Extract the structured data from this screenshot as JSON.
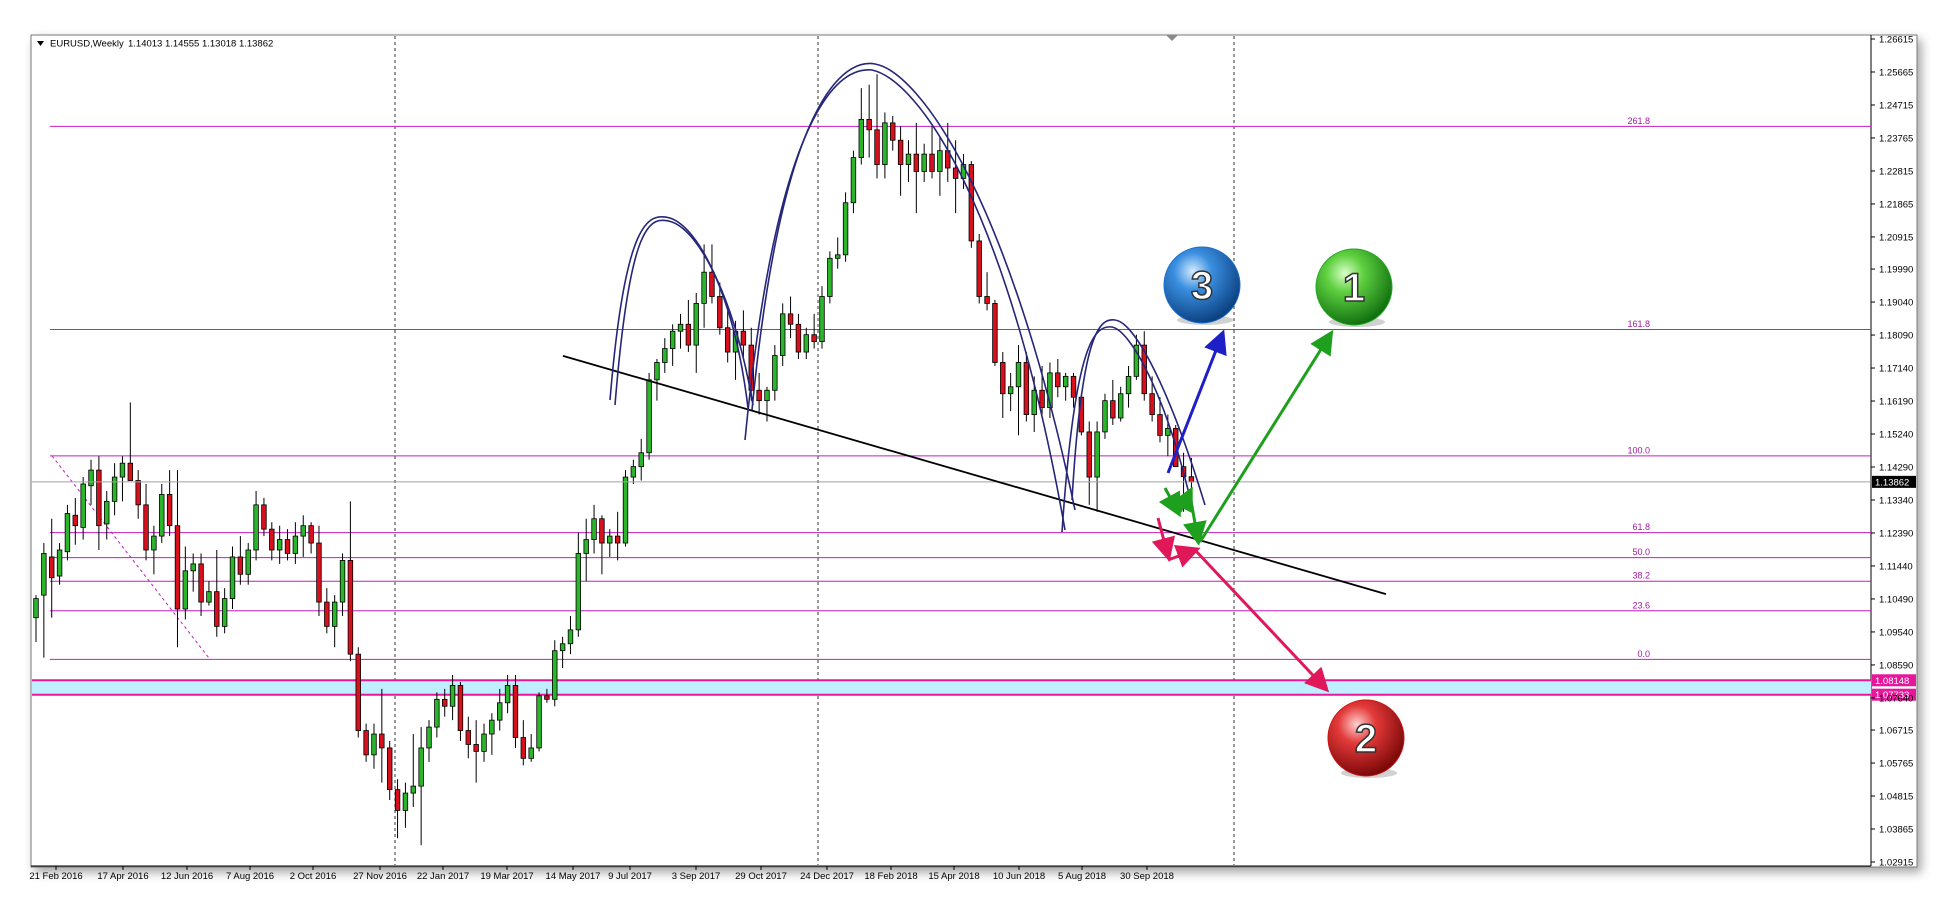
{
  "chart_data": {
    "type": "candlestick",
    "header": {
      "symbol_line": "EURUSD,Weekly",
      "ohlc_line": "1.14013 1.14555 1.13018 1.13862"
    },
    "y_axis": {
      "ylim": [
        1.02915,
        1.26615
      ],
      "ticks": [
        "1.26615",
        "1.25665",
        "1.24715",
        "1.23765",
        "1.22815",
        "1.21865",
        "1.20915",
        "1.19990",
        "1.19040",
        "1.18090",
        "1.17140",
        "1.16190",
        "1.15240",
        "1.14290",
        "1.13340",
        "1.12390",
        "1.11440",
        "1.10490",
        "1.09540",
        "1.08590",
        "1.07640",
        "1.06715",
        "1.05765",
        "1.04815",
        "1.03865",
        "1.02915"
      ]
    },
    "x_axis": {
      "ticks": [
        "21 Feb 2016",
        "17 Apr 2016",
        "12 Jun 2016",
        "7 Aug 2016",
        "2 Oct 2016",
        "27 Nov 2016",
        "22 Jan 2017",
        "19 Mar 2017",
        "14 May 2017",
        "9 Jul 2017",
        "3 Sep 2017",
        "29 Oct 2017",
        "24 Dec 2017",
        "18 Feb 2018",
        "15 Apr 2018",
        "10 Jun 2018",
        "5 Aug 2018",
        "30 Sep 2018"
      ]
    },
    "current_price": {
      "label": "1.13862",
      "value": 1.13862,
      "color": "#000000"
    },
    "support_zone": {
      "top": 1.08148,
      "bottom": 1.07733,
      "top_label": "1.08148",
      "bottom_label": "1.07733",
      "color": "#bfefff"
    },
    "fib_levels": [
      {
        "label": "261.8",
        "value": 1.241
      },
      {
        "label": "161.8",
        "value": 1.1825
      },
      {
        "label": "100.0",
        "value": 1.1461
      },
      {
        "label": "61.8",
        "value": 1.124
      },
      {
        "label": "50.0",
        "value": 1.1168
      },
      {
        "label": "38.2",
        "value": 1.11
      },
      {
        "label": "23.6",
        "value": 1.1015
      },
      {
        "label": "0.0",
        "value": 1.0875
      }
    ],
    "trendline": {
      "from": [
        0,
        1.1749
      ],
      "to": [
        147,
        1.1063
      ],
      "color": "#000000"
    },
    "candles": [
      [
        1.0995,
        1.106,
        1.0925,
        1.105
      ],
      [
        1.106,
        1.121,
        1.088,
        1.118
      ],
      [
        1.117,
        1.128,
        1.0995,
        1.111
      ],
      [
        1.1115,
        1.121,
        1.109,
        1.119
      ],
      [
        1.1185,
        1.132,
        1.116,
        1.1295
      ],
      [
        1.129,
        1.134,
        1.1205,
        1.126
      ],
      [
        1.1255,
        1.14,
        1.122,
        1.138
      ],
      [
        1.1375,
        1.145,
        1.132,
        1.142
      ],
      [
        1.142,
        1.146,
        1.119,
        1.126
      ],
      [
        1.1265,
        1.136,
        1.122,
        1.133
      ],
      [
        1.133,
        1.144,
        1.129,
        1.14
      ],
      [
        1.14,
        1.146,
        1.133,
        1.144
      ],
      [
        1.144,
        1.1615,
        1.139,
        1.139
      ],
      [
        1.139,
        1.142,
        1.128,
        1.132
      ],
      [
        1.132,
        1.138,
        1.116,
        1.119
      ],
      [
        1.119,
        1.126,
        1.112,
        1.123
      ],
      [
        1.123,
        1.138,
        1.121,
        1.135
      ],
      [
        1.135,
        1.142,
        1.123,
        1.126
      ],
      [
        1.126,
        1.142,
        1.091,
        1.102
      ],
      [
        1.102,
        1.12,
        1.099,
        1.113
      ],
      [
        1.113,
        1.118,
        1.107,
        1.115
      ],
      [
        1.115,
        1.118,
        1.1,
        1.104
      ],
      [
        1.104,
        1.11,
        1.103,
        1.107
      ],
      [
        1.107,
        1.119,
        1.094,
        1.097
      ],
      [
        1.097,
        1.108,
        1.095,
        1.105
      ],
      [
        1.105,
        1.12,
        1.102,
        1.117
      ],
      [
        1.117,
        1.123,
        1.109,
        1.112
      ],
      [
        1.112,
        1.121,
        1.109,
        1.119
      ],
      [
        1.119,
        1.136,
        1.116,
        1.132
      ],
      [
        1.132,
        1.134,
        1.123,
        1.125
      ],
      [
        1.125,
        1.127,
        1.116,
        1.119
      ],
      [
        1.119,
        1.126,
        1.115,
        1.122
      ],
      [
        1.122,
        1.125,
        1.116,
        1.118
      ],
      [
        1.118,
        1.127,
        1.115,
        1.123
      ],
      [
        1.123,
        1.129,
        1.117,
        1.126
      ],
      [
        1.126,
        1.127,
        1.118,
        1.121
      ],
      [
        1.121,
        1.126,
        1.1,
        1.104
      ],
      [
        1.104,
        1.108,
        1.095,
        1.097
      ],
      [
        1.097,
        1.106,
        1.091,
        1.104
      ],
      [
        1.104,
        1.118,
        1.1,
        1.116
      ],
      [
        1.116,
        1.133,
        1.087,
        1.089
      ],
      [
        1.089,
        1.091,
        1.065,
        1.067
      ],
      [
        1.067,
        1.069,
        1.058,
        1.06
      ],
      [
        1.06,
        1.069,
        1.056,
        1.066
      ],
      [
        1.066,
        1.079,
        1.052,
        1.062
      ],
      [
        1.062,
        1.064,
        1.047,
        1.05
      ],
      [
        1.05,
        1.053,
        1.036,
        1.044
      ],
      [
        1.044,
        1.052,
        1.039,
        1.049
      ],
      [
        1.049,
        1.066,
        1.045,
        1.051
      ],
      [
        1.051,
        1.068,
        1.034,
        1.062
      ],
      [
        1.062,
        1.07,
        1.058,
        1.068
      ],
      [
        1.068,
        1.078,
        1.065,
        1.076
      ],
      [
        1.076,
        1.079,
        1.071,
        1.074
      ],
      [
        1.074,
        1.083,
        1.07,
        1.08
      ],
      [
        1.08,
        1.081,
        1.064,
        1.067
      ],
      [
        1.067,
        1.071,
        1.059,
        1.063
      ],
      [
        1.063,
        1.07,
        1.052,
        1.061
      ],
      [
        1.061,
        1.069,
        1.058,
        1.066
      ],
      [
        1.066,
        1.072,
        1.06,
        1.07
      ],
      [
        1.07,
        1.079,
        1.067,
        1.075
      ],
      [
        1.075,
        1.083,
        1.072,
        1.08
      ],
      [
        1.08,
        1.083,
        1.062,
        1.065
      ],
      [
        1.065,
        1.07,
        1.057,
        1.059
      ],
      [
        1.059,
        1.066,
        1.058,
        1.062
      ],
      [
        1.062,
        1.078,
        1.061,
        1.077
      ],
      [
        1.077,
        1.079,
        1.075,
        1.076
      ],
      [
        1.076,
        1.093,
        1.074,
        1.09
      ],
      [
        1.09,
        1.094,
        1.085,
        1.092
      ],
      [
        1.092,
        1.1,
        1.089,
        1.096
      ],
      [
        1.096,
        1.124,
        1.094,
        1.118
      ],
      [
        1.118,
        1.128,
        1.11,
        1.122
      ],
      [
        1.122,
        1.132,
        1.118,
        1.128
      ],
      [
        1.128,
        1.129,
        1.112,
        1.121
      ],
      [
        1.121,
        1.125,
        1.117,
        1.123
      ],
      [
        1.123,
        1.13,
        1.116,
        1.121
      ],
      [
        1.121,
        1.142,
        1.12,
        1.14
      ],
      [
        1.14,
        1.145,
        1.138,
        1.143
      ],
      [
        1.143,
        1.151,
        1.139,
        1.147
      ],
      [
        1.147,
        1.17,
        1.145,
        1.168
      ],
      [
        1.168,
        1.174,
        1.162,
        1.173
      ],
      [
        1.173,
        1.18,
        1.17,
        1.177
      ],
      [
        1.177,
        1.184,
        1.172,
        1.182
      ],
      [
        1.182,
        1.187,
        1.177,
        1.184
      ],
      [
        1.184,
        1.191,
        1.176,
        1.178
      ],
      [
        1.178,
        1.193,
        1.17,
        1.19
      ],
      [
        1.19,
        1.207,
        1.183,
        1.199
      ],
      [
        1.199,
        1.207,
        1.19,
        1.192
      ],
      [
        1.192,
        1.196,
        1.181,
        1.183
      ],
      [
        1.183,
        1.188,
        1.173,
        1.176
      ],
      [
        1.176,
        1.185,
        1.168,
        1.182
      ],
      [
        1.182,
        1.188,
        1.174,
        1.178
      ],
      [
        1.178,
        1.183,
        1.162,
        1.165
      ],
      [
        1.165,
        1.17,
        1.158,
        1.162
      ],
      [
        1.162,
        1.166,
        1.156,
        1.165
      ],
      [
        1.165,
        1.178,
        1.162,
        1.175
      ],
      [
        1.175,
        1.19,
        1.172,
        1.187
      ],
      [
        1.187,
        1.192,
        1.18,
        1.184
      ],
      [
        1.184,
        1.187,
        1.174,
        1.176
      ],
      [
        1.176,
        1.183,
        1.174,
        1.181
      ],
      [
        1.181,
        1.187,
        1.177,
        1.179
      ],
      [
        1.179,
        1.195,
        1.177,
        1.192
      ],
      [
        1.192,
        1.205,
        1.19,
        1.203
      ],
      [
        1.203,
        1.209,
        1.2,
        1.204
      ],
      [
        1.204,
        1.222,
        1.202,
        1.219
      ],
      [
        1.219,
        1.234,
        1.216,
        1.232
      ],
      [
        1.232,
        1.252,
        1.23,
        1.243
      ],
      [
        1.243,
        1.253,
        1.232,
        1.24
      ],
      [
        1.24,
        1.256,
        1.226,
        1.23
      ],
      [
        1.23,
        1.245,
        1.226,
        1.242
      ],
      [
        1.242,
        1.244,
        1.234,
        1.237
      ],
      [
        1.237,
        1.241,
        1.221,
        1.23
      ],
      [
        1.23,
        1.237,
        1.225,
        1.233
      ],
      [
        1.233,
        1.242,
        1.216,
        1.228
      ],
      [
        1.228,
        1.236,
        1.225,
        1.233
      ],
      [
        1.233,
        1.241,
        1.226,
        1.228
      ],
      [
        1.228,
        1.238,
        1.221,
        1.234
      ],
      [
        1.234,
        1.242,
        1.225,
        1.229
      ],
      [
        1.229,
        1.237,
        1.216,
        1.226
      ],
      [
        1.226,
        1.233,
        1.223,
        1.23
      ],
      [
        1.23,
        1.231,
        1.206,
        1.208
      ],
      [
        1.208,
        1.21,
        1.19,
        1.192
      ],
      [
        1.192,
        1.199,
        1.188,
        1.19
      ],
      [
        1.19,
        1.191,
        1.172,
        1.173
      ],
      [
        1.173,
        1.176,
        1.157,
        1.164
      ],
      [
        1.164,
        1.17,
        1.159,
        1.166
      ],
      [
        1.166,
        1.178,
        1.152,
        1.173
      ],
      [
        1.173,
        1.176,
        1.156,
        1.158
      ],
      [
        1.158,
        1.169,
        1.153,
        1.165
      ],
      [
        1.165,
        1.172,
        1.158,
        1.16
      ],
      [
        1.16,
        1.173,
        1.157,
        1.17
      ],
      [
        1.17,
        1.174,
        1.163,
        1.166
      ],
      [
        1.166,
        1.17,
        1.162,
        1.169
      ],
      [
        1.169,
        1.17,
        1.16,
        1.163
      ],
      [
        1.163,
        1.164,
        1.152,
        1.153
      ],
      [
        1.153,
        1.156,
        1.132,
        1.14
      ],
      [
        1.14,
        1.156,
        1.13,
        1.153
      ],
      [
        1.153,
        1.164,
        1.151,
        1.162
      ],
      [
        1.162,
        1.168,
        1.155,
        1.157
      ],
      [
        1.157,
        1.166,
        1.156,
        1.164
      ],
      [
        1.164,
        1.172,
        1.16,
        1.169
      ],
      [
        1.169,
        1.181,
        1.168,
        1.178
      ],
      [
        1.178,
        1.182,
        1.162,
        1.164
      ],
      [
        1.164,
        1.169,
        1.156,
        1.158
      ],
      [
        1.158,
        1.163,
        1.15,
        1.152
      ],
      [
        1.152,
        1.158,
        1.146,
        1.154
      ],
      [
        1.154,
        1.155,
        1.143,
        1.143
      ],
      [
        1.143,
        1.147,
        1.13,
        1.1401
      ],
      [
        1.1401,
        1.14555,
        1.13018,
        1.13862
      ]
    ],
    "annotation_markers": [
      {
        "label": "1",
        "color": "#22aa22"
      },
      {
        "label": "2",
        "color": "#cc1111"
      },
      {
        "label": "3",
        "color": "#1a6fd0"
      }
    ]
  }
}
